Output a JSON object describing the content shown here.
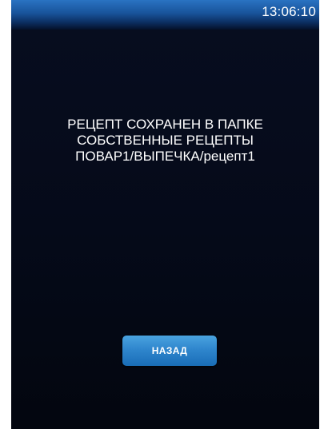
{
  "status_bar": {
    "time": "13:06:10"
  },
  "message": {
    "lines": [
      "РЕЦЕПТ СОХРАНЕН В ПАПКЕ",
      "СОБСТВЕННЫЕ РЕЦЕПТЫ",
      "ПОВАР1/ВЫПЕЧКА/рецепт1"
    ]
  },
  "actions": {
    "back_label": "НАЗАД"
  },
  "colors": {
    "status_bar_top": "#2a73c2",
    "background": "#050a19",
    "button": "#2f86cd",
    "text": "#ffffff"
  }
}
